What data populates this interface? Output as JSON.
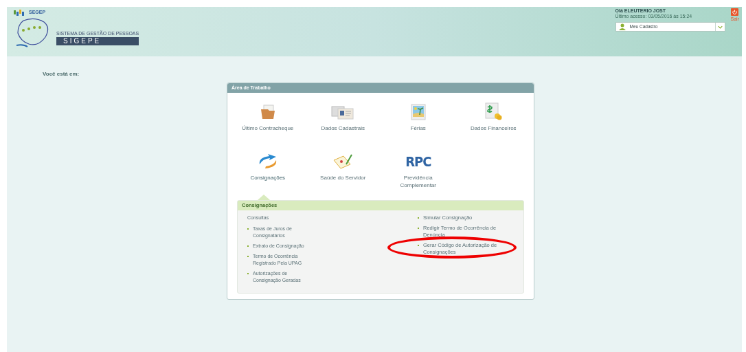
{
  "header": {
    "brand": "SEGEP",
    "logo_subtitle": "SISTEMA DE GESTÃO DE PESSOAS",
    "logo_title": "SIGEPE",
    "greeting": "Olá ELEUTERIO JOST",
    "last_access": "Último acesso: 03/05/2016 às 15:24",
    "profile_select": "Meu Cadastro",
    "logout": "Sair"
  },
  "breadcrumb_label": "Você está em:",
  "workspace": {
    "title": "Área de Trabalho",
    "items": [
      {
        "label": "Último Contracheque",
        "selected": false
      },
      {
        "label": "Dados Cadastrais",
        "selected": false
      },
      {
        "label": "Férias",
        "selected": false
      },
      {
        "label": "Dados Financeiros",
        "selected": false
      },
      {
        "label": "Consignações",
        "selected": true
      },
      {
        "label": "Saúde do Servidor",
        "selected": false
      },
      {
        "label": "Previdência Complementar",
        "selected": false
      }
    ],
    "rpc_icon_text": "RPC",
    "submenu": {
      "title": "Consignações",
      "columns": [
        [
          {
            "label": "Consultas",
            "children": [
              {
                "label": "Taxas de Juros de Consignatários"
              },
              {
                "label": "Extrato de Consignação"
              },
              {
                "label": "Termo de Ocorrência Registrado Pela UPAG"
              },
              {
                "label": "Autorizações de Consignação Geradas"
              }
            ]
          }
        ],
        [
          {
            "label": "Simular Consignação"
          },
          {
            "label": "Redigir Termo de Ocorrência de Denúncia"
          },
          {
            "label": "Gerar Código de Autorização de Consignações",
            "highlighted": true
          }
        ]
      ]
    }
  }
}
